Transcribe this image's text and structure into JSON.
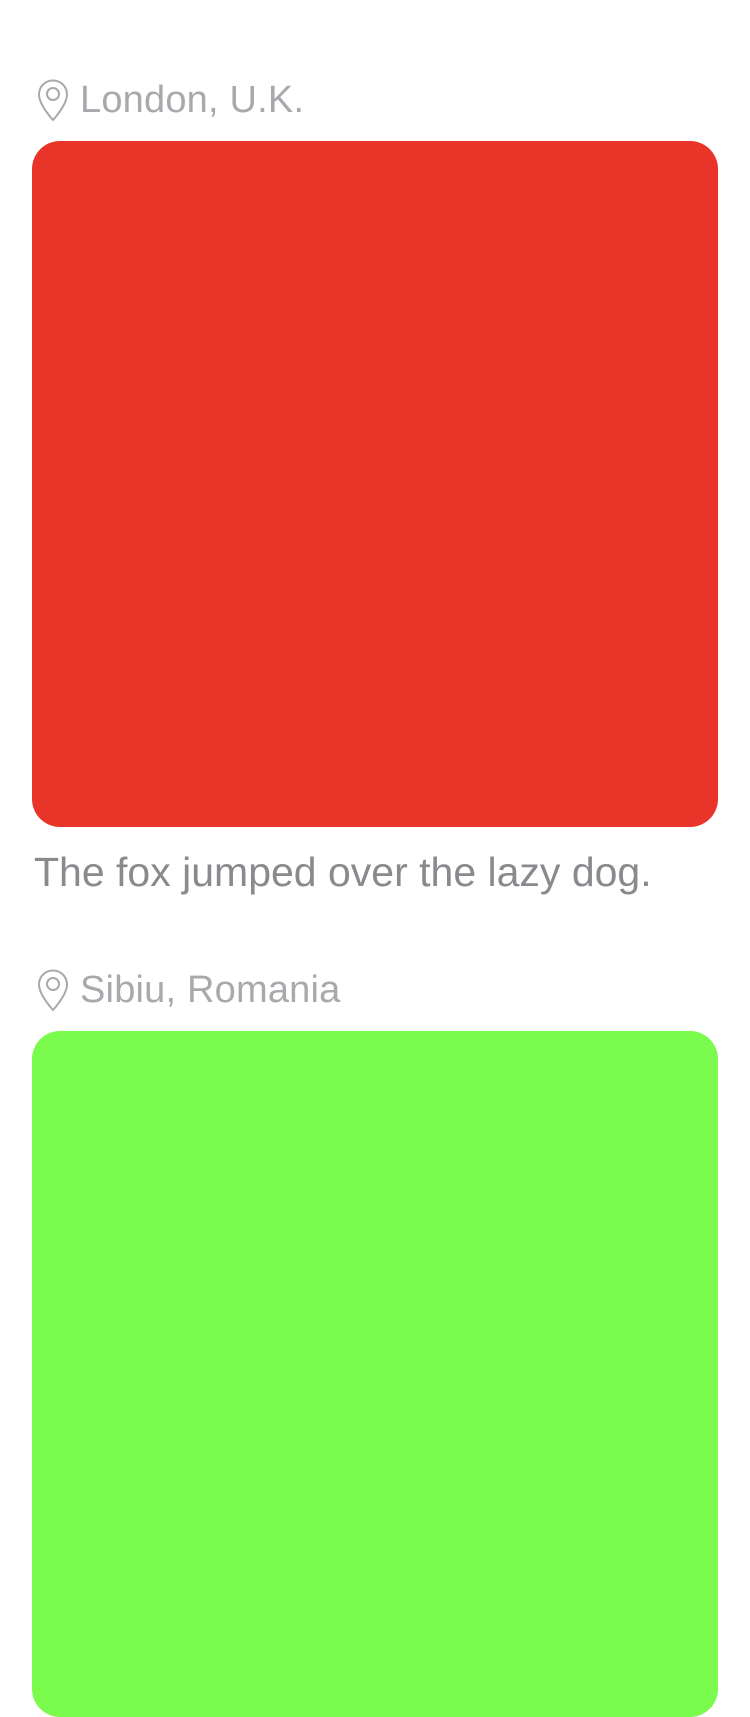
{
  "feed": {
    "posts": [
      {
        "location": "London, U.K.",
        "location_icon": "map-pin-icon",
        "photo_color": "#E9342A",
        "caption": "The fox jumped over the lazy dog."
      },
      {
        "location": "Sibiu, Romania",
        "location_icon": "map-pin-icon",
        "photo_color": "#7AFB4E",
        "caption": ""
      }
    ]
  },
  "colors": {
    "background": "#FFFFFF",
    "location_text": "#A9A9AD",
    "caption_text": "#8A8A8E"
  }
}
